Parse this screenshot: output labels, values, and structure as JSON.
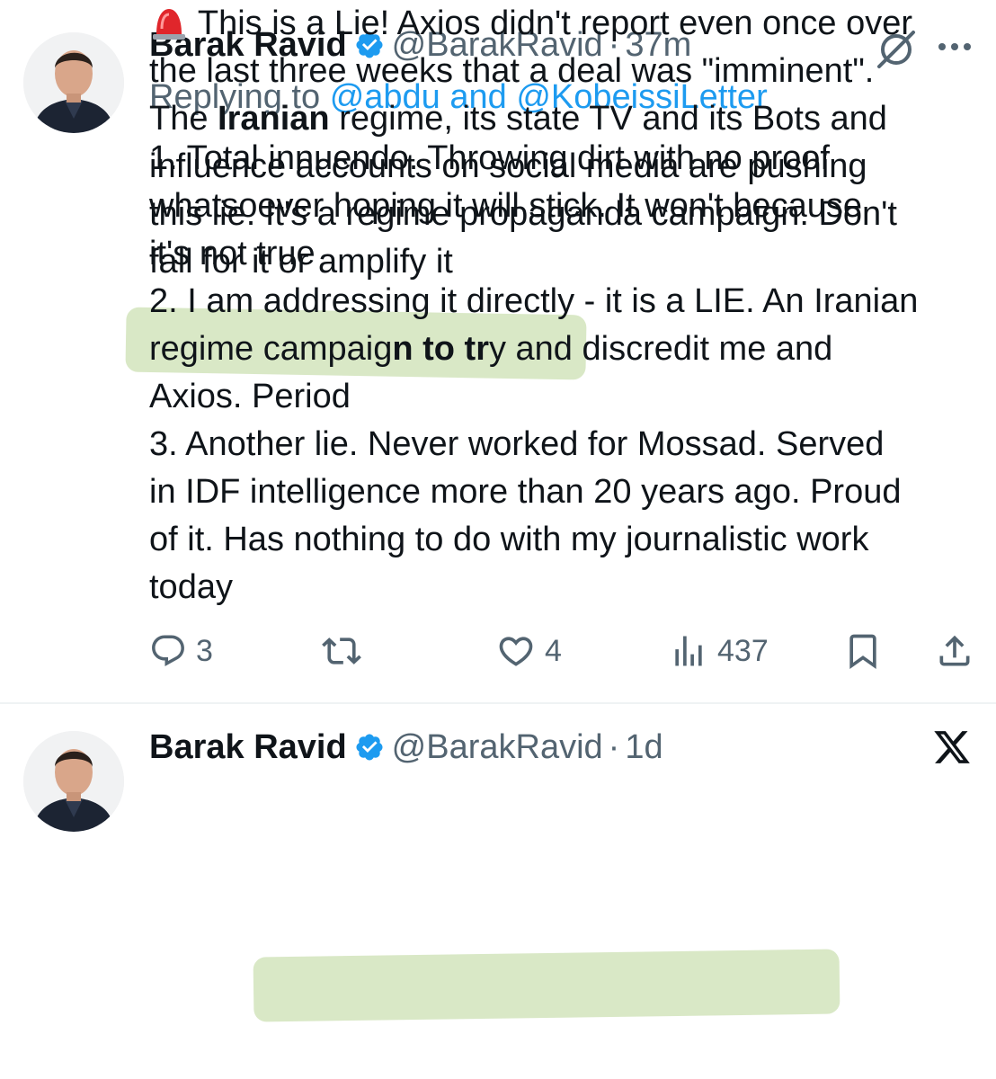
{
  "tweets": [
    {
      "author_name": "Barak Ravid",
      "handle": "@BarakRavid",
      "separator": "·",
      "time": "37m",
      "reply_prefix": "Replying to",
      "reply_mention_1": "@abdu",
      "reply_and": "and",
      "reply_mention_2": "@KobeissiLetter",
      "lines": [
        "1. Total innuendo. Throwing dirt with no proof",
        "whatsoever hoping it will stick. It won't because",
        "it's not true",
        "2. I am addressing it directly - it is a LIE. An Iranian",
        "regime campaig",
        "n to tr",
        "y and discredit me and",
        "Axios. Period",
        "3. Another lie. Never worked for Mossad. Served",
        "in IDF intelligence more than 20 years ago. Proud",
        "of it. Has nothing to do with my journalistic work",
        "today"
      ],
      "actions": {
        "replies": "3",
        "retweets": "",
        "likes": "4",
        "views": "437"
      },
      "icons": [
        "verified-badge-icon",
        "mute-icon",
        "more-icon",
        "reply-icon",
        "retweet-icon",
        "like-icon",
        "views-icon",
        "bookmark-icon",
        "share-icon"
      ]
    },
    {
      "author_name": "Barak Ravid",
      "handle": "@BarakRavid",
      "separator": "·",
      "time": "1d",
      "emoji": "🚨",
      "lines": [
        " This is a Lie! Axios didn't report even once over",
        "the last three weeks that a deal was \"imminent\".",
        "The ",
        "Iranian",
        " regime, its state TV and its Bots and",
        "influence accounts on social media are pushing",
        "this lie. It's a regime propaganda campaign. Don't",
        "fall for it or amplify it"
      ],
      "icons": [
        "verified-badge-icon",
        "x-logo-icon",
        "siren-icon"
      ]
    }
  ],
  "colors": {
    "verified": "#1d9bf0",
    "mention": "#1d9bf0",
    "secondary_text": "#536471",
    "highlight": "#a4c878"
  }
}
